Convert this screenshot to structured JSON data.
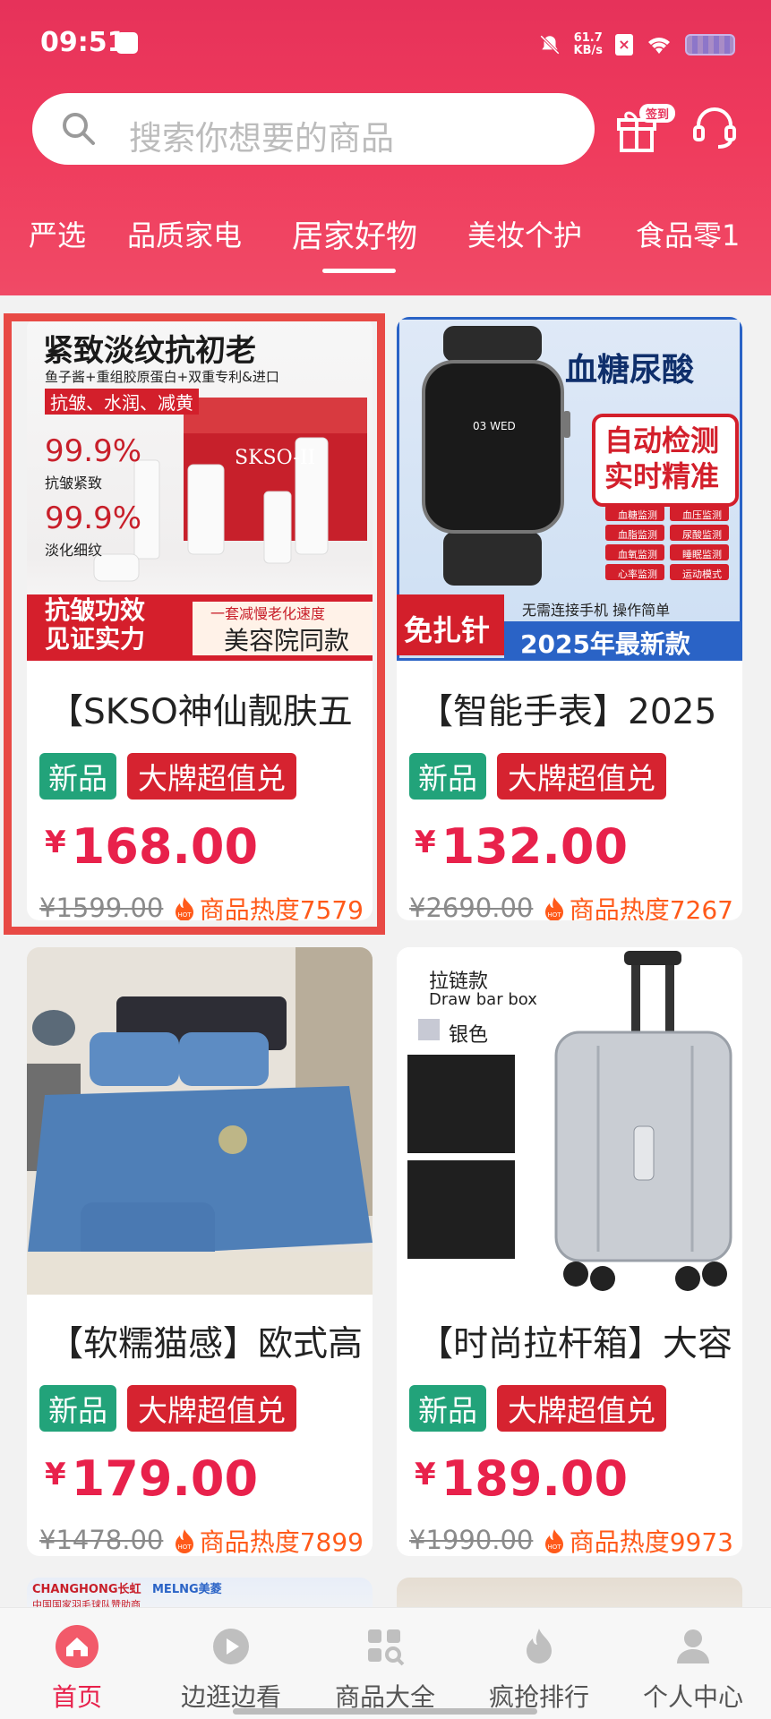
{
  "status_bar": {
    "time": "09:51",
    "speed_value": "61.7",
    "speed_unit": "KB/s"
  },
  "search": {
    "placeholder": "搜索你想要的商品"
  },
  "header": {
    "checkin_badge": "签到"
  },
  "category_tabs": [
    "严选",
    "品质家电",
    "居家好物",
    "美妆个护",
    "食品零1"
  ],
  "active_tab": "居家好物",
  "products": [
    {
      "title": "【SKSO神仙靓肤五",
      "tag_new": "新品",
      "tag_brand": "大牌超值兑",
      "price_symbol": "¥",
      "price": "168.00",
      "original_price": "¥1599.00",
      "heat": "商品热度7579",
      "image": {
        "headline": "紧致淡纹抗初老",
        "sub": "鱼子酱+重组胶原蛋白+双重专利&进口",
        "tags": "抗皱、水润、减黄",
        "stat1": "99.9%",
        "stat1_label": "抗皱紧致",
        "stat2": "99.9%",
        "stat2_label": "淡化细纹",
        "brand": "SKSO-II",
        "bottom_left1": "抗皱功效",
        "bottom_left2": "见证实力",
        "bottom_right_top": "一套减慢老化速度",
        "bottom_right": "美容院同款"
      }
    },
    {
      "title": "【智能手表】2025",
      "tag_new": "新品",
      "tag_brand": "大牌超值兑",
      "price_symbol": "¥",
      "price": "132.00",
      "original_price": "¥2690.00",
      "heat": "商品热度7267",
      "image": {
        "headline": "血糖尿酸",
        "box1": "自动检测",
        "box2": "实时精准",
        "features": [
          "血糖监测",
          "血压监测",
          "血脂监测",
          "尿酸监测",
          "血氧监测",
          "睡眠监测",
          "心率监测",
          "运动模式"
        ],
        "watch_date": "03 WED",
        "badge": "免扎针",
        "sub": "无需连接手机  操作简单",
        "bottom": "2025年最新款"
      }
    },
    {
      "title": "【软糯猫感】欧式高",
      "tag_new": "新品",
      "tag_brand": "大牌超值兑",
      "price_symbol": "¥",
      "price": "179.00",
      "original_price": "¥1478.00",
      "heat": "商品热度7899"
    },
    {
      "title": "【时尚拉杆箱】大容",
      "tag_new": "新品",
      "tag_brand": "大牌超值兑",
      "price_symbol": "¥",
      "price": "189.00",
      "original_price": "¥1990.00",
      "heat": "商品热度9973",
      "image": {
        "label_cn": "拉链款",
        "label_en": "Draw bar box",
        "color": "银色"
      }
    }
  ],
  "partial_row": {
    "brand1": "CHANGHONG长虹",
    "brand2": "MELNG美菱",
    "strip": "中国国家羽毛球队赞助商"
  },
  "bottom_nav": [
    {
      "label": "首页",
      "icon": "home-icon"
    },
    {
      "label": "边逛边看",
      "icon": "play-icon"
    },
    {
      "label": "商品大全",
      "icon": "grid-search-icon"
    },
    {
      "label": "疯抢排行",
      "icon": "fire-icon"
    },
    {
      "label": "个人中心",
      "icon": "user-icon"
    }
  ],
  "colors": {
    "accent": "#e8214b",
    "header": "#ef3a5c",
    "tag_new": "#22a37a",
    "tag_brand": "#d62330",
    "heat": "#ff5a1a"
  }
}
